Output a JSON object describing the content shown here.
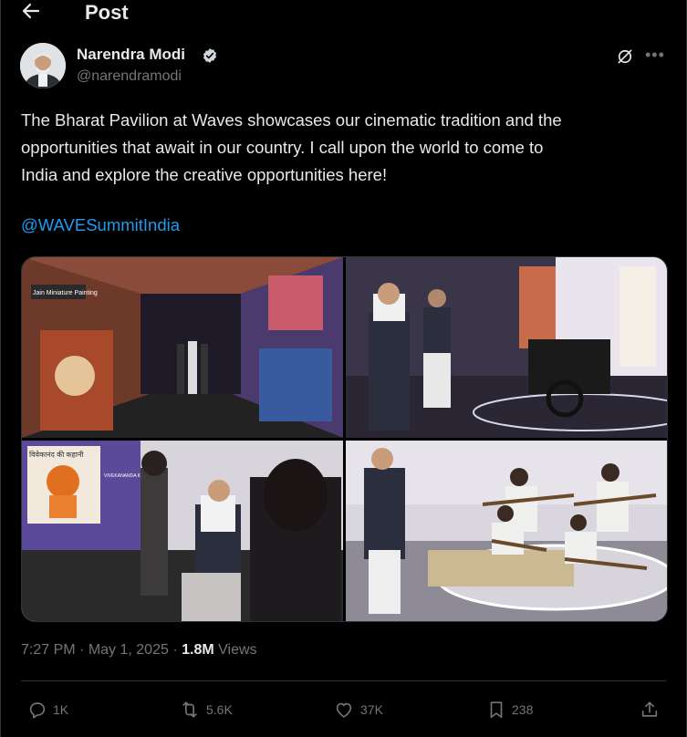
{
  "header": {
    "back_icon": "arrow-left-icon",
    "title": "Post"
  },
  "author": {
    "name": "Narendra Modi",
    "handle": "@narendramodi",
    "verified": true,
    "badge_color": "#1d9bf0"
  },
  "post": {
    "text": "The Bharat Pavilion at Waves showcases our cinematic tradition and the\nopportunities that await in our country. I call upon the world to come to\nIndia and explore the creative opportunities here!",
    "mention": "@WAVESummitIndia",
    "images": [
      {
        "description": "Immersive exhibit tunnel with miniature painting projections"
      },
      {
        "description": "Visitors beside a vintage printing press"
      },
      {
        "description": "Exhibit screen with Vivekananda audiobook"
      },
      {
        "description": "Musicians playing string instruments on a stage"
      }
    ],
    "time": "7:27 PM",
    "date": "May 1, 2025",
    "views_count": "1.8M",
    "views_label": "Views"
  },
  "actions": {
    "reply": {
      "icon": "reply-icon",
      "count": "1K"
    },
    "repost": {
      "icon": "repost-icon",
      "count": "5.6K"
    },
    "like": {
      "icon": "heart-icon",
      "count": "37K"
    },
    "bookmark": {
      "icon": "bookmark-icon",
      "count": "238"
    },
    "share": {
      "icon": "share-icon"
    }
  },
  "image_text": {
    "panel1_sign": "Jain Miniature Painting",
    "panel3_title": "विवेकानंद की कहानी",
    "panel3_caption": "VIVEKANANDA KI KAHANI"
  },
  "colors": {
    "background": "#000000",
    "text": "#e7e9ea",
    "secondary": "#71767b",
    "link": "#1d9bf0",
    "border": "#2f3336"
  }
}
